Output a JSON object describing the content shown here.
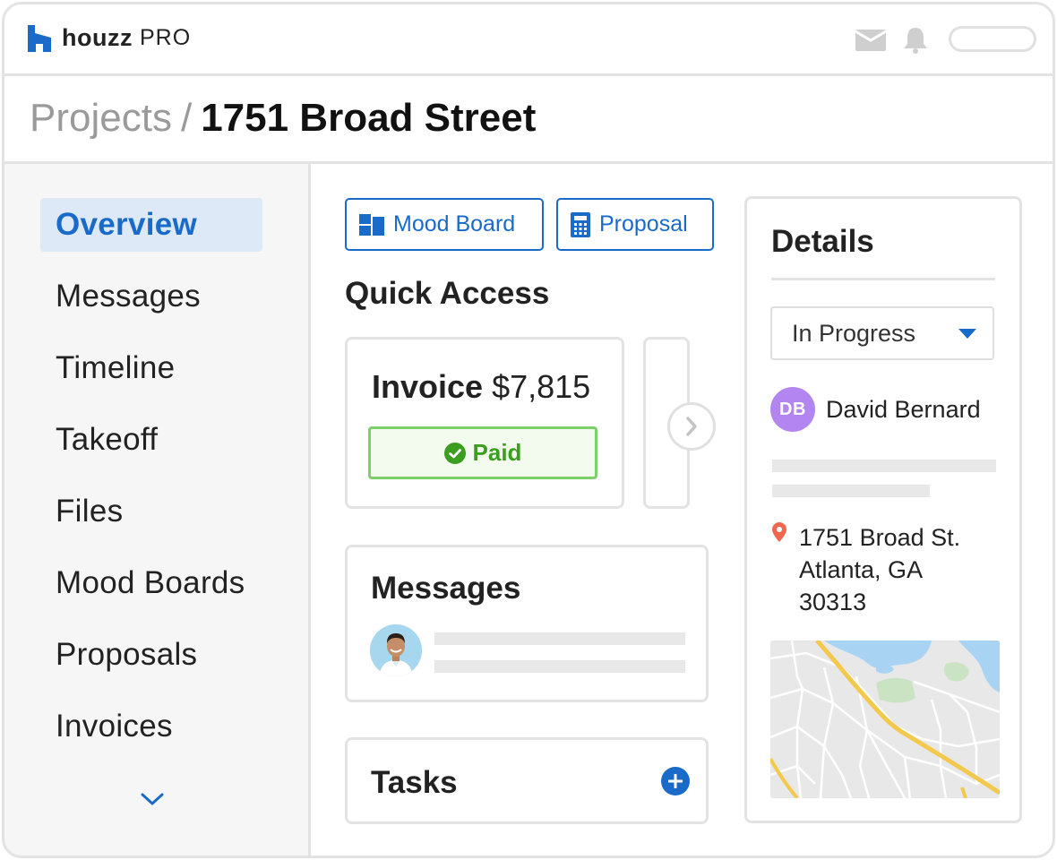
{
  "app": {
    "brand": "houzz",
    "brand_suffix": "PRO"
  },
  "topbar": {
    "mail_icon": "mail-icon",
    "bell_icon": "bell-icon"
  },
  "breadcrumb": {
    "root": "Projects",
    "separator": "/",
    "current": "1751 Broad Street"
  },
  "sidebar": {
    "items": [
      {
        "label": "Overview",
        "active": true
      },
      {
        "label": "Messages",
        "active": false
      },
      {
        "label": "Timeline",
        "active": false
      },
      {
        "label": "Takeoff",
        "active": false
      },
      {
        "label": "Files",
        "active": false
      },
      {
        "label": "Mood Boards",
        "active": false
      },
      {
        "label": "Proposals",
        "active": false
      },
      {
        "label": "Invoices",
        "active": false
      }
    ],
    "more_icon": "chevron-down-icon"
  },
  "actions": {
    "mood_board_label": "Mood Board",
    "proposal_label": "Proposal"
  },
  "quick_access": {
    "title": "Quick Access",
    "invoice_label": "Invoice",
    "invoice_amount": "$7,815",
    "invoice_status": "Paid"
  },
  "messages_card": {
    "title": "Messages"
  },
  "tasks_card": {
    "title": "Tasks"
  },
  "details": {
    "title": "Details",
    "status": "In Progress",
    "contact_initials": "DB",
    "contact_name": "David Bernard",
    "address_line1": "1751 Broad St.",
    "address_line2": "Atlanta, GA",
    "address_line3": "30313"
  },
  "colors": {
    "accent": "#1a6bc9",
    "paid_green": "#3c9e1f",
    "avatar_purple": "#b385f0",
    "pin_red": "#f0674f"
  }
}
